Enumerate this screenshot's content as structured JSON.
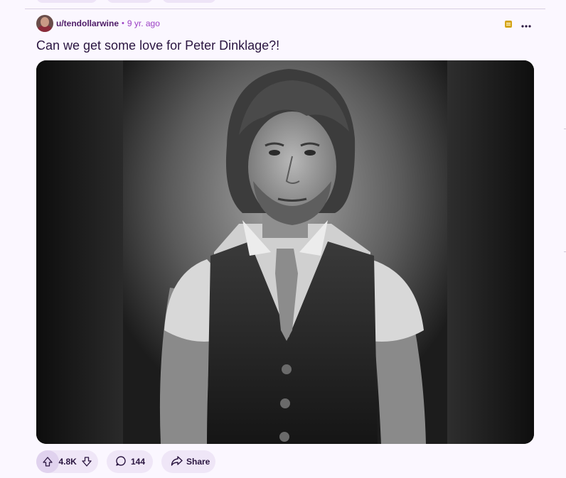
{
  "post": {
    "author": "u/tendollarwine",
    "separator": "•",
    "age": "9 yr. ago",
    "title": "Can we get some love for Peter Dinklage?!",
    "image_subject": "black-and-white portrait of a man in a dark vest and tie",
    "score": "4.8K",
    "comments": "144",
    "share_label": "Share"
  },
  "icons": {
    "award": "award-icon",
    "more": "more-options-icon",
    "upvote": "upvote-arrow-icon",
    "downvote": "downvote-arrow-icon",
    "comment": "comment-bubble-icon",
    "share": "share-arrow-icon"
  },
  "colors": {
    "background": "#fbf7ff",
    "username": "#4d1b66",
    "timestamp": "#9b3fc4",
    "pill": "#efe6f7",
    "award": "#d4a418"
  }
}
